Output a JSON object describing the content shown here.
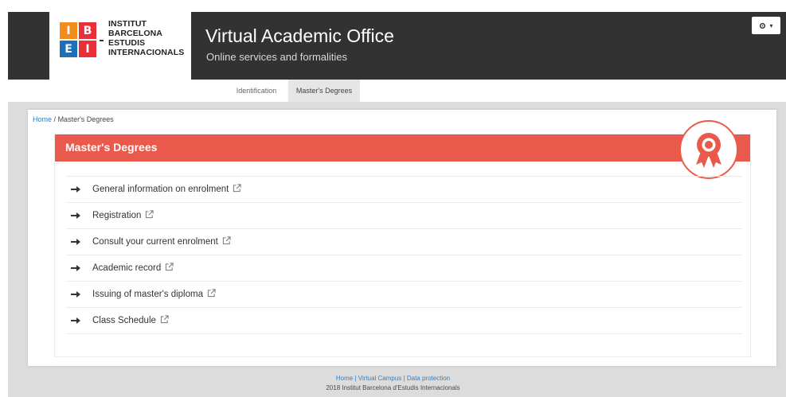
{
  "header": {
    "logo": {
      "cells": [
        "I",
        "B",
        "E",
        "I"
      ],
      "text_lines": [
        "INSTITUT",
        "BARCELONA",
        "ESTUDIS",
        "INTERNACIONALS"
      ]
    },
    "title": "Virtual Academic Office",
    "subtitle": "Online services and formalities",
    "user_menu": {
      "icon": "gear-icon",
      "caret": "▾"
    }
  },
  "nav": {
    "tabs": [
      {
        "label": "Identification",
        "active": false
      },
      {
        "label": "Master's Degrees",
        "active": true
      }
    ]
  },
  "breadcrumb": {
    "home": "Home",
    "separator": "/",
    "current": "Master's Degrees"
  },
  "card": {
    "title": "Master's Degrees",
    "badge_icon": "award-ribbon-icon",
    "items": [
      {
        "label": "General information on enrolment"
      },
      {
        "label": "Registration"
      },
      {
        "label": "Consult your current enrolment"
      },
      {
        "label": "Academic record"
      },
      {
        "label": "Issuing of master's diploma"
      },
      {
        "label": "Class Schedule"
      }
    ]
  },
  "footer": {
    "links": [
      "Home",
      "Virtual Campus",
      "Data protection"
    ],
    "links_text": "Home | Virtual Campus | Data protection",
    "copyright": "2018 Institut Barcelona d'Estudis Internacionals"
  },
  "colors": {
    "header_bg": "#323232",
    "accent_red": "#ea5a4c",
    "logo_orange": "#f28c1e",
    "logo_blue": "#1c6fb8",
    "link_blue": "#2c7bc5"
  }
}
